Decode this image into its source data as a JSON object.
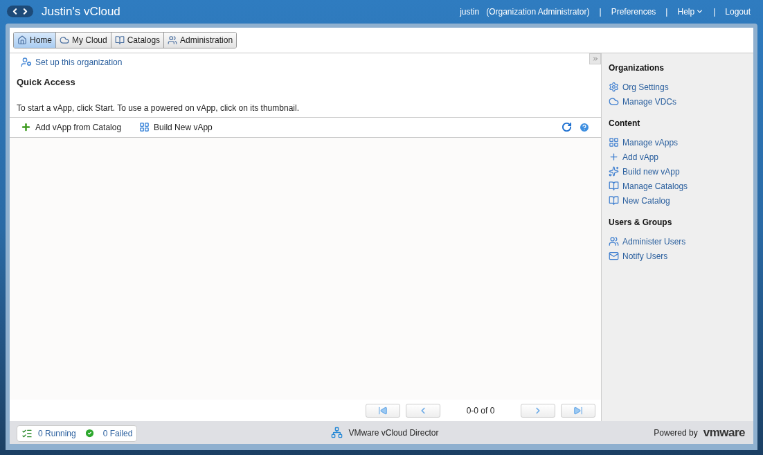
{
  "header": {
    "title": "Justin's vCloud",
    "user": "justin",
    "role": "(Organization Administrator)",
    "separator": "|",
    "links": [
      {
        "label": "Preferences",
        "kind": "link"
      },
      {
        "label": "Help",
        "kind": "menu"
      },
      {
        "label": "Logout",
        "kind": "link"
      }
    ]
  },
  "tabs": [
    {
      "label": "Home",
      "selected": true
    },
    {
      "label": "My Cloud",
      "selected": false
    },
    {
      "label": "Catalogs",
      "selected": false
    },
    {
      "label": "Administration",
      "selected": false
    }
  ],
  "main": {
    "setup_link": "Set up this organization",
    "heading": "Quick Access",
    "instructions": "To start a vApp, click Start. To use a powered on vApp, click on its thumbnail.",
    "toolbar": [
      "Add vApp from Catalog",
      "Build New vApp"
    ],
    "pager": "0-0 of 0"
  },
  "sidebar": [
    {
      "heading": "Organizations",
      "items": [
        "Org Settings",
        "Manage VDCs"
      ]
    },
    {
      "heading": "Content",
      "items": [
        "Manage vApps",
        "Add vApp",
        "Build new vApp",
        "Manage Catalogs",
        "New Catalog"
      ]
    },
    {
      "heading": "Users & Groups",
      "items": [
        "Administer Users",
        "Notify Users"
      ]
    }
  ],
  "status_bar": {
    "running": "0 Running",
    "failed": "0 Failed",
    "product": "VMware vCloud Director",
    "powered_by": "Powered by",
    "brand": "vmware"
  }
}
